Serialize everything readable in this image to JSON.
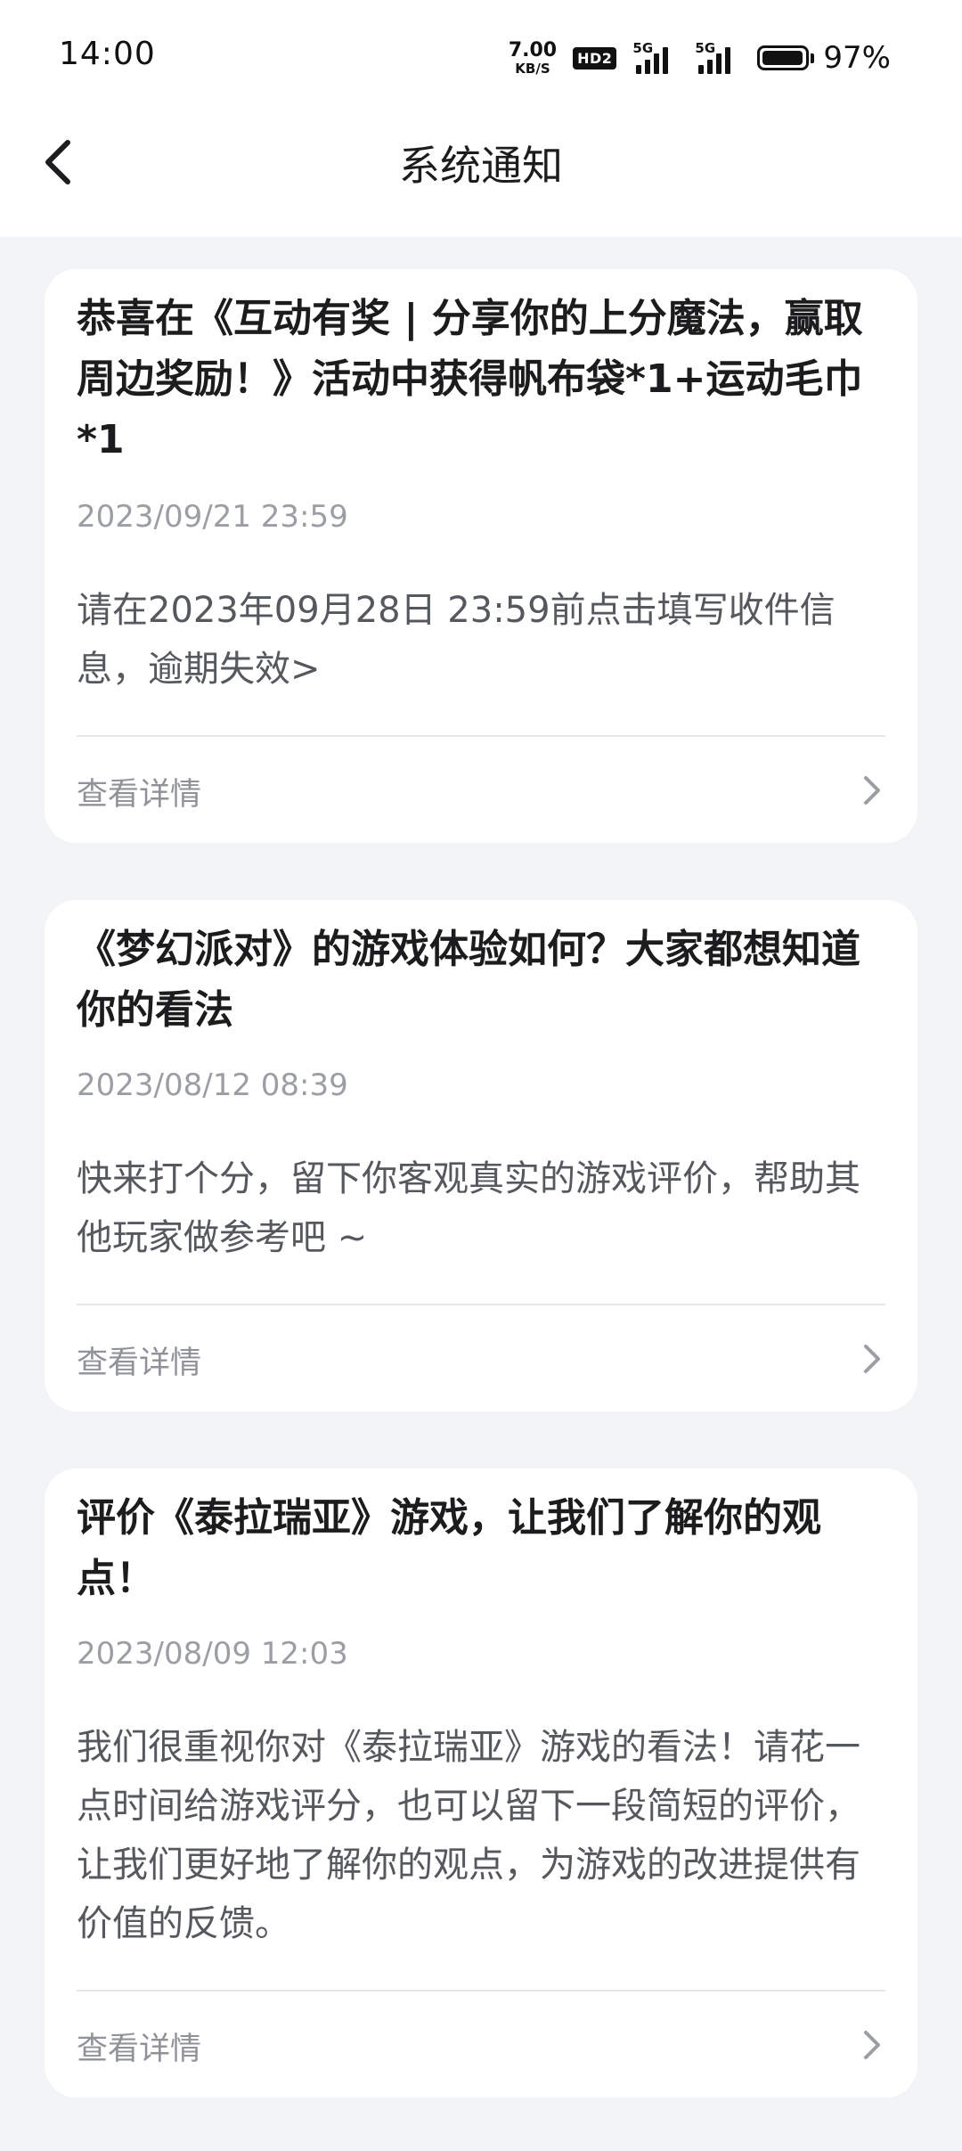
{
  "status_bar": {
    "time": "14:00",
    "net_speed_value": "7.00",
    "net_speed_unit": "KB/S",
    "hd_badge": "HD2",
    "signal1_label": "5G",
    "signal2_label": "5G",
    "battery_percent": "97%"
  },
  "nav": {
    "title": "系统通知",
    "back_icon": "chevron-left-icon"
  },
  "notifications": [
    {
      "title": "恭喜在《互动有奖 | 分享你的上分魔法，赢取周边奖励！》活动中获得帆布袋*1+运动毛巾*1",
      "date": "2023/09/21 23:59",
      "body": "请在2023年09月28日 23:59前点击填写收件信息，逾期失效>",
      "detail_label": "查看详情"
    },
    {
      "title": "《梦幻派对》的游戏体验如何？大家都想知道你的看法",
      "date": "2023/08/12 08:39",
      "body": "快来打个分，留下你客观真实的游戏评价，帮助其他玩家做参考吧 ~",
      "detail_label": "查看详情"
    },
    {
      "title": "评价《泰拉瑞亚》游戏，让我们了解你的观点！",
      "date": "2023/08/09 12:03",
      "body": "我们很重视你对《泰拉瑞亚》游戏的看法！请花一点时间给游戏评分，也可以留下一段简短的评价，让我们更好地了解你的观点，为游戏的改进提供有价值的反馈。",
      "detail_label": "查看详情"
    }
  ],
  "colors": {
    "page_background": "#f3f4f6",
    "card_background": "#ffffff",
    "title_text": "#1c1c1e",
    "date_text": "#9b9ea3",
    "body_text": "#55585d",
    "divider": "#e6e7e9"
  }
}
